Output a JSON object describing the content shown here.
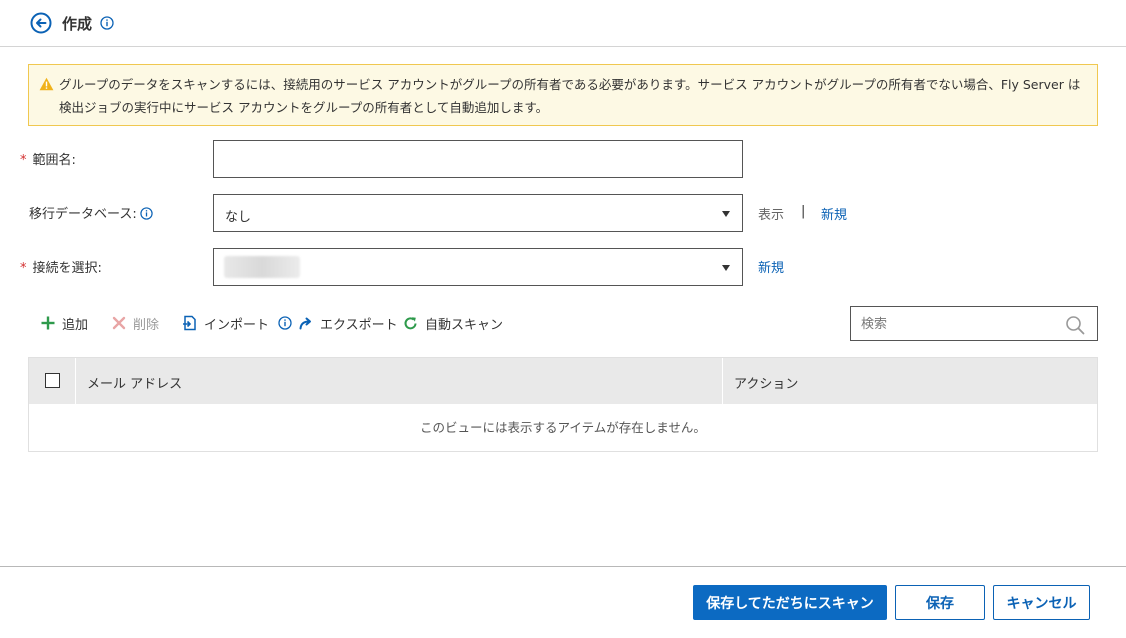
{
  "header": {
    "title": "作成"
  },
  "warning": {
    "text": "グループのデータをスキャンするには、接続用のサービス アカウントがグループの所有者である必要があります。サービス アカウントがグループの所有者でない場合、Fly Server は検出ジョブの実行中にサービス アカウントをグループの所有者として自動追加します。"
  },
  "form": {
    "scope_name": {
      "label": "範囲名:",
      "value": ""
    },
    "migration_db": {
      "label": "移行データベース:",
      "selected": "なし",
      "view_link": "表示",
      "separator": "|",
      "new_link": "新規"
    },
    "connection": {
      "label": "接続を選択:",
      "selected": "",
      "new_link": "新規"
    }
  },
  "toolbar": {
    "add": "追加",
    "delete": "削除",
    "import": "インポート",
    "export": "エクスポート",
    "auto_scan": "自動スキャン",
    "search_placeholder": "検索"
  },
  "table": {
    "columns": [
      "メール アドレス",
      "アクション"
    ],
    "rows": [],
    "empty_message": "このビューには表示するアイテムが存在しません。"
  },
  "footer": {
    "save_and_scan": "保存してただちにスキャン",
    "save": "保存",
    "cancel": "キャンセル"
  },
  "colors": {
    "accent": "#0c6ac2",
    "warning_bg": "#fdf9e4",
    "warning_border": "#f0c850",
    "required": "#d32f2f"
  }
}
